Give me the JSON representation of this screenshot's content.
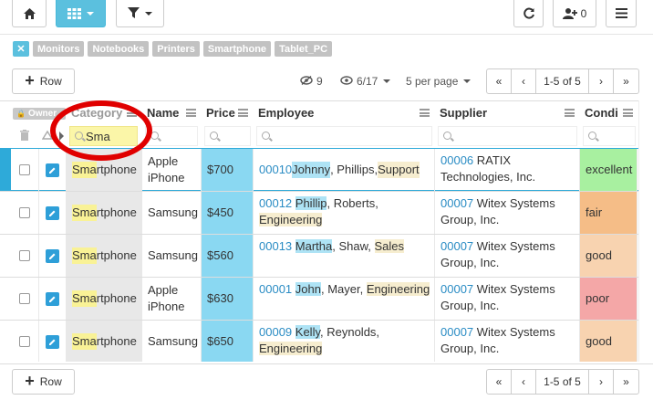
{
  "toolbar": {
    "home_icon": "home-icon",
    "grid_icon": "grid-icon",
    "filter_icon": "filter-icon",
    "refresh_icon": "refresh-icon",
    "add_user_icon": "add-user-icon",
    "user_count": "0",
    "menu_icon": "hamburger-icon"
  },
  "tags": [
    "Monitors",
    "Notebooks",
    "Printers",
    "Smartphone",
    "Tablet_PC"
  ],
  "pager": {
    "row_label": "Row",
    "hidden_count": "9",
    "visible_cols": "6/17",
    "per_page": "5 per page",
    "first": "«",
    "prev": "‹",
    "range": "1-5 of 5",
    "next": "›",
    "last": "»"
  },
  "columns": {
    "owner": "Owner",
    "category": "Category",
    "name": "Name",
    "price": "Price",
    "employee": "Employee",
    "supplier": "Supplier",
    "condition": "Condi"
  },
  "filters": {
    "category": "Sma"
  },
  "rows": [
    {
      "cat_hl": "Sma",
      "cat_rest": "rtphone",
      "name": "Apple iPhone",
      "price": "$700",
      "emp_id": "00010",
      "emp_first": "Johnny",
      "emp_mid": ", Phillips, ",
      "emp_dept": "Support",
      "sup_id": "00006",
      "sup_name": " RATIX Technologies, Inc.",
      "cond": "excellent",
      "cond_color": "#a8f0a0"
    },
    {
      "cat_hl": "Sma",
      "cat_rest": "rtphone",
      "name": "Samsung",
      "price": "$450",
      "emp_id": "00012",
      "emp_first": "Phillip",
      "emp_mid": ", Roberts, ",
      "emp_dept": "Engineering",
      "sup_id": "00007",
      "sup_name": " Witex Systems Group, Inc.",
      "cond": "fair",
      "cond_color": "#f5bd87"
    },
    {
      "cat_hl": "Sma",
      "cat_rest": "rtphone",
      "name": "Samsung",
      "price": "$560",
      "emp_id": "00013",
      "emp_first": "Martha",
      "emp_mid": ", Shaw, ",
      "emp_dept": "Sales",
      "sup_id": "00007",
      "sup_name": " Witex Systems Group, Inc.",
      "cond": "good",
      "cond_color": "#f8d3b0"
    },
    {
      "cat_hl": "Sma",
      "cat_rest": "rtphone",
      "name": "Apple iPhone",
      "price": "$630",
      "emp_id": "00001",
      "emp_first": "John",
      "emp_mid": ", Mayer, ",
      "emp_dept": "Engineering",
      "sup_id": "00007",
      "sup_name": " Witex Systems Group, Inc.",
      "cond": "poor",
      "cond_color": "#f4a7a7"
    },
    {
      "cat_hl": "Sma",
      "cat_rest": "rtphone",
      "name": "Samsung",
      "price": "$650",
      "emp_id": "00009",
      "emp_first": "Kelly",
      "emp_mid": ", Reynolds, ",
      "emp_dept": "Engineering",
      "sup_id": "00007",
      "sup_name": " Witex Systems Group, Inc.",
      "cond": "good",
      "cond_color": "#f8d3b0"
    }
  ]
}
